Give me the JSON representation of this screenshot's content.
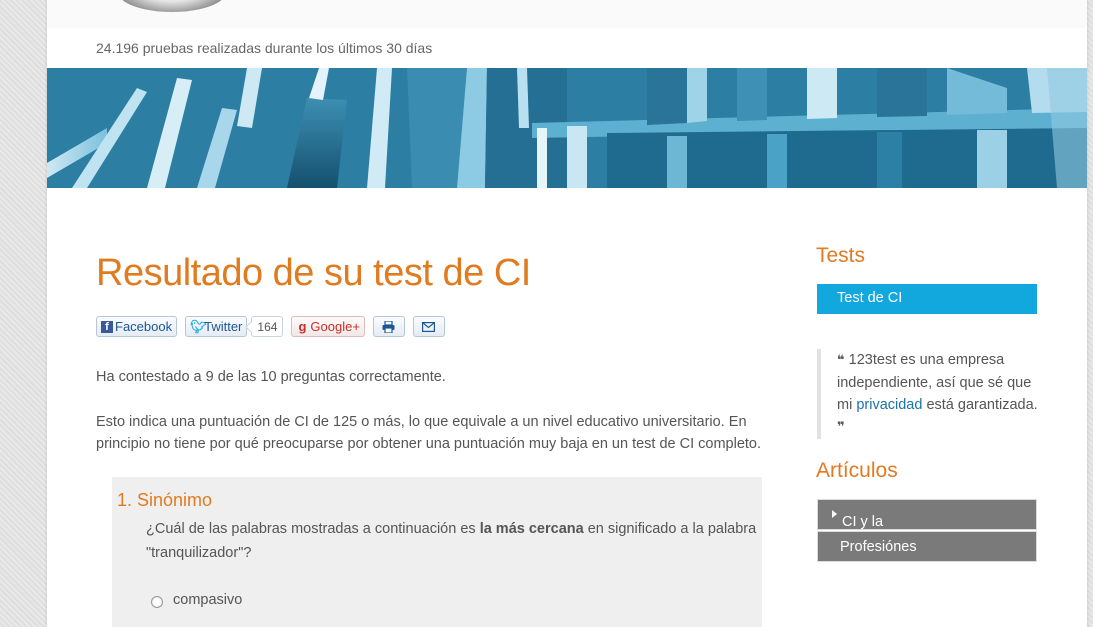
{
  "header": {
    "tests_count": "24.196 pruebas realizadas durante los últimos 30 días"
  },
  "main": {
    "title": "Resultado de su test de CI",
    "share": {
      "facebook": "Facebook",
      "twitter": "Twitter",
      "twitter_count": "164",
      "googleplus": "Google+",
      "print_icon": "printer-icon",
      "email_icon": "envelope-icon"
    },
    "result_text": "Ha contestado a 9 de las 10 preguntas correctamente.",
    "explanation": "Esto indica una puntuación de CI de 125 o más, lo que equivale a un nivel educativo universitario. En principio no tiene por qué preocuparse por obtener una puntuación muy baja en un test de CI completo.",
    "question": {
      "title": "1. Sinónimo",
      "text_before": "¿Cuál de las palabras mostradas a continuación es ",
      "text_bold": "la más cercana",
      "text_after": " en significado a la palabra \"tranquilizador\"?",
      "option_1": "compasivo"
    }
  },
  "sidebar": {
    "tests_heading": "Tests",
    "test_button": "Test de CI",
    "quote_before": "123test es una empresa independiente, así que sé que mi ",
    "quote_link": "privacidad",
    "quote_after": " está garantizada.",
    "articles_heading": "Artículos",
    "articles": [
      "CI y la inteligencia",
      "Profesiónes"
    ]
  },
  "colors": {
    "accent_orange": "#e07b1f",
    "button_blue": "#12a7dd",
    "link_blue": "#1c73a8"
  }
}
